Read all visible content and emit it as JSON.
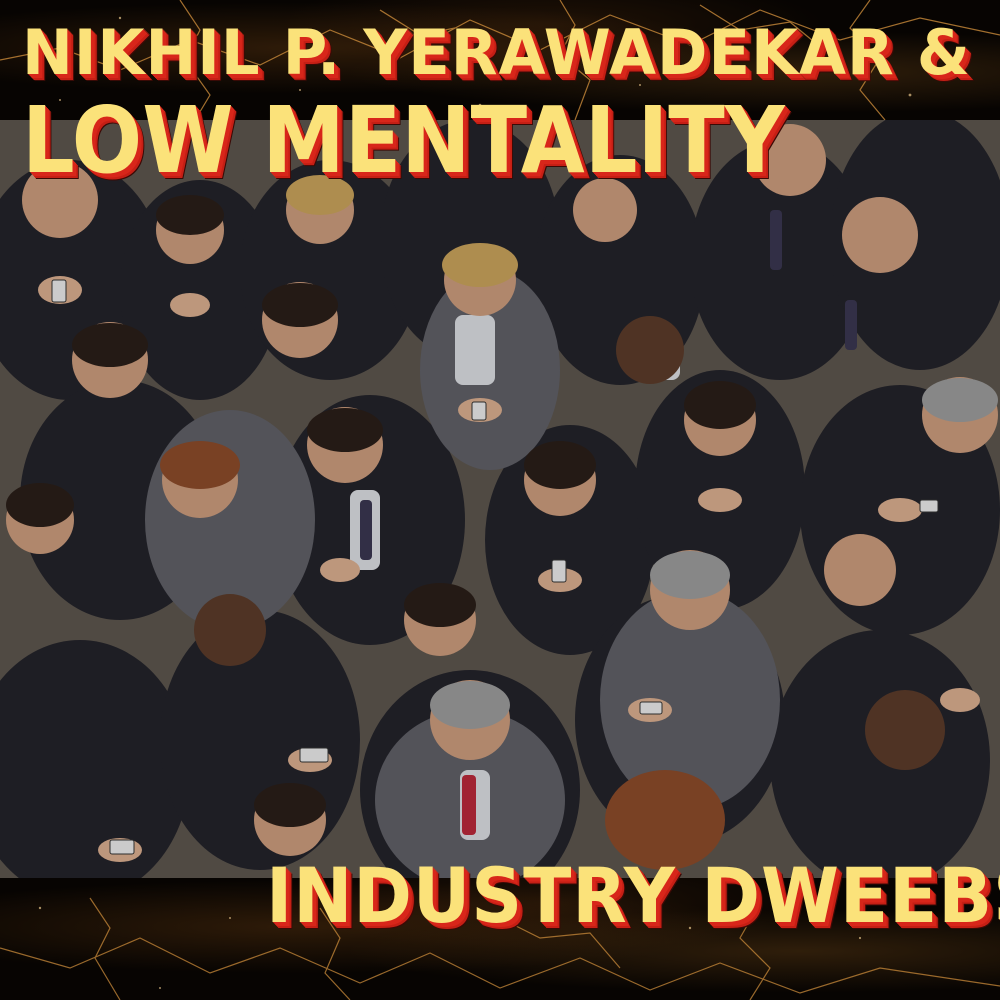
{
  "cover": {
    "artist_line_1": "NIKHIL P. YERAWADEKAR &",
    "artist_line_2": "LOW MENTALITY",
    "album_title": "INDUSTRY DWEEBS"
  },
  "colors": {
    "title_fill": "#fbe27a",
    "title_shadow": "#d8261a",
    "background": "#050302",
    "crack_glow": "#c98a3a"
  }
}
